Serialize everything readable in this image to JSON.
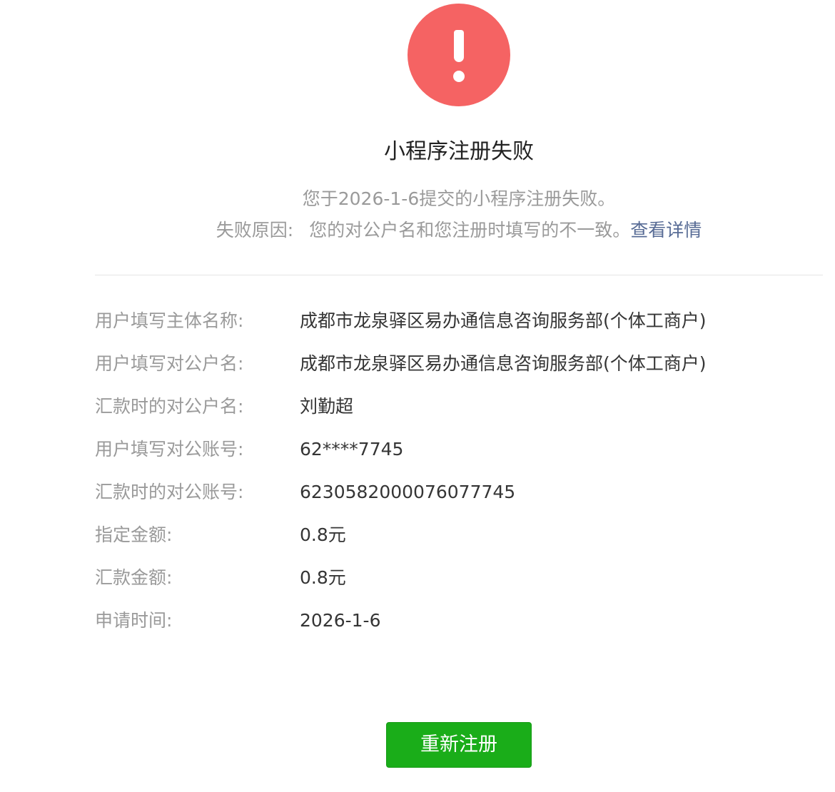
{
  "status": {
    "icon": "exclamation-circle-icon",
    "color": "#f56363"
  },
  "title": "小程序注册失败",
  "description": {
    "line1": "您于2026-1-6提交的小程序注册失败。",
    "reason_label": "失败原因:",
    "reason_text": "您的对公户名和您注册时填写的不一致。",
    "detail_link": "查看详情"
  },
  "info": [
    {
      "label": "用户填写主体名称:",
      "value": "成都市龙泉驿区易办通信息咨询服务部(个体工商户)"
    },
    {
      "label": "用户填写对公户名:",
      "value": "成都市龙泉驿区易办通信息咨询服务部(个体工商户)"
    },
    {
      "label": "汇款时的对公户名:",
      "value": "刘勤超"
    },
    {
      "label": "用户填写对公账号:",
      "value": "62****7745"
    },
    {
      "label": "汇款时的对公账号:",
      "value": "6230582000076077745"
    },
    {
      "label": "指定金额:",
      "value": "0.8元"
    },
    {
      "label": "汇款金额:",
      "value": "0.8元"
    },
    {
      "label": "申请时间:",
      "value": "2026-1-6"
    }
  ],
  "actions": {
    "re_register_label": "重新注册",
    "button_color": "#1aad19",
    "link_color": "#576b95"
  }
}
